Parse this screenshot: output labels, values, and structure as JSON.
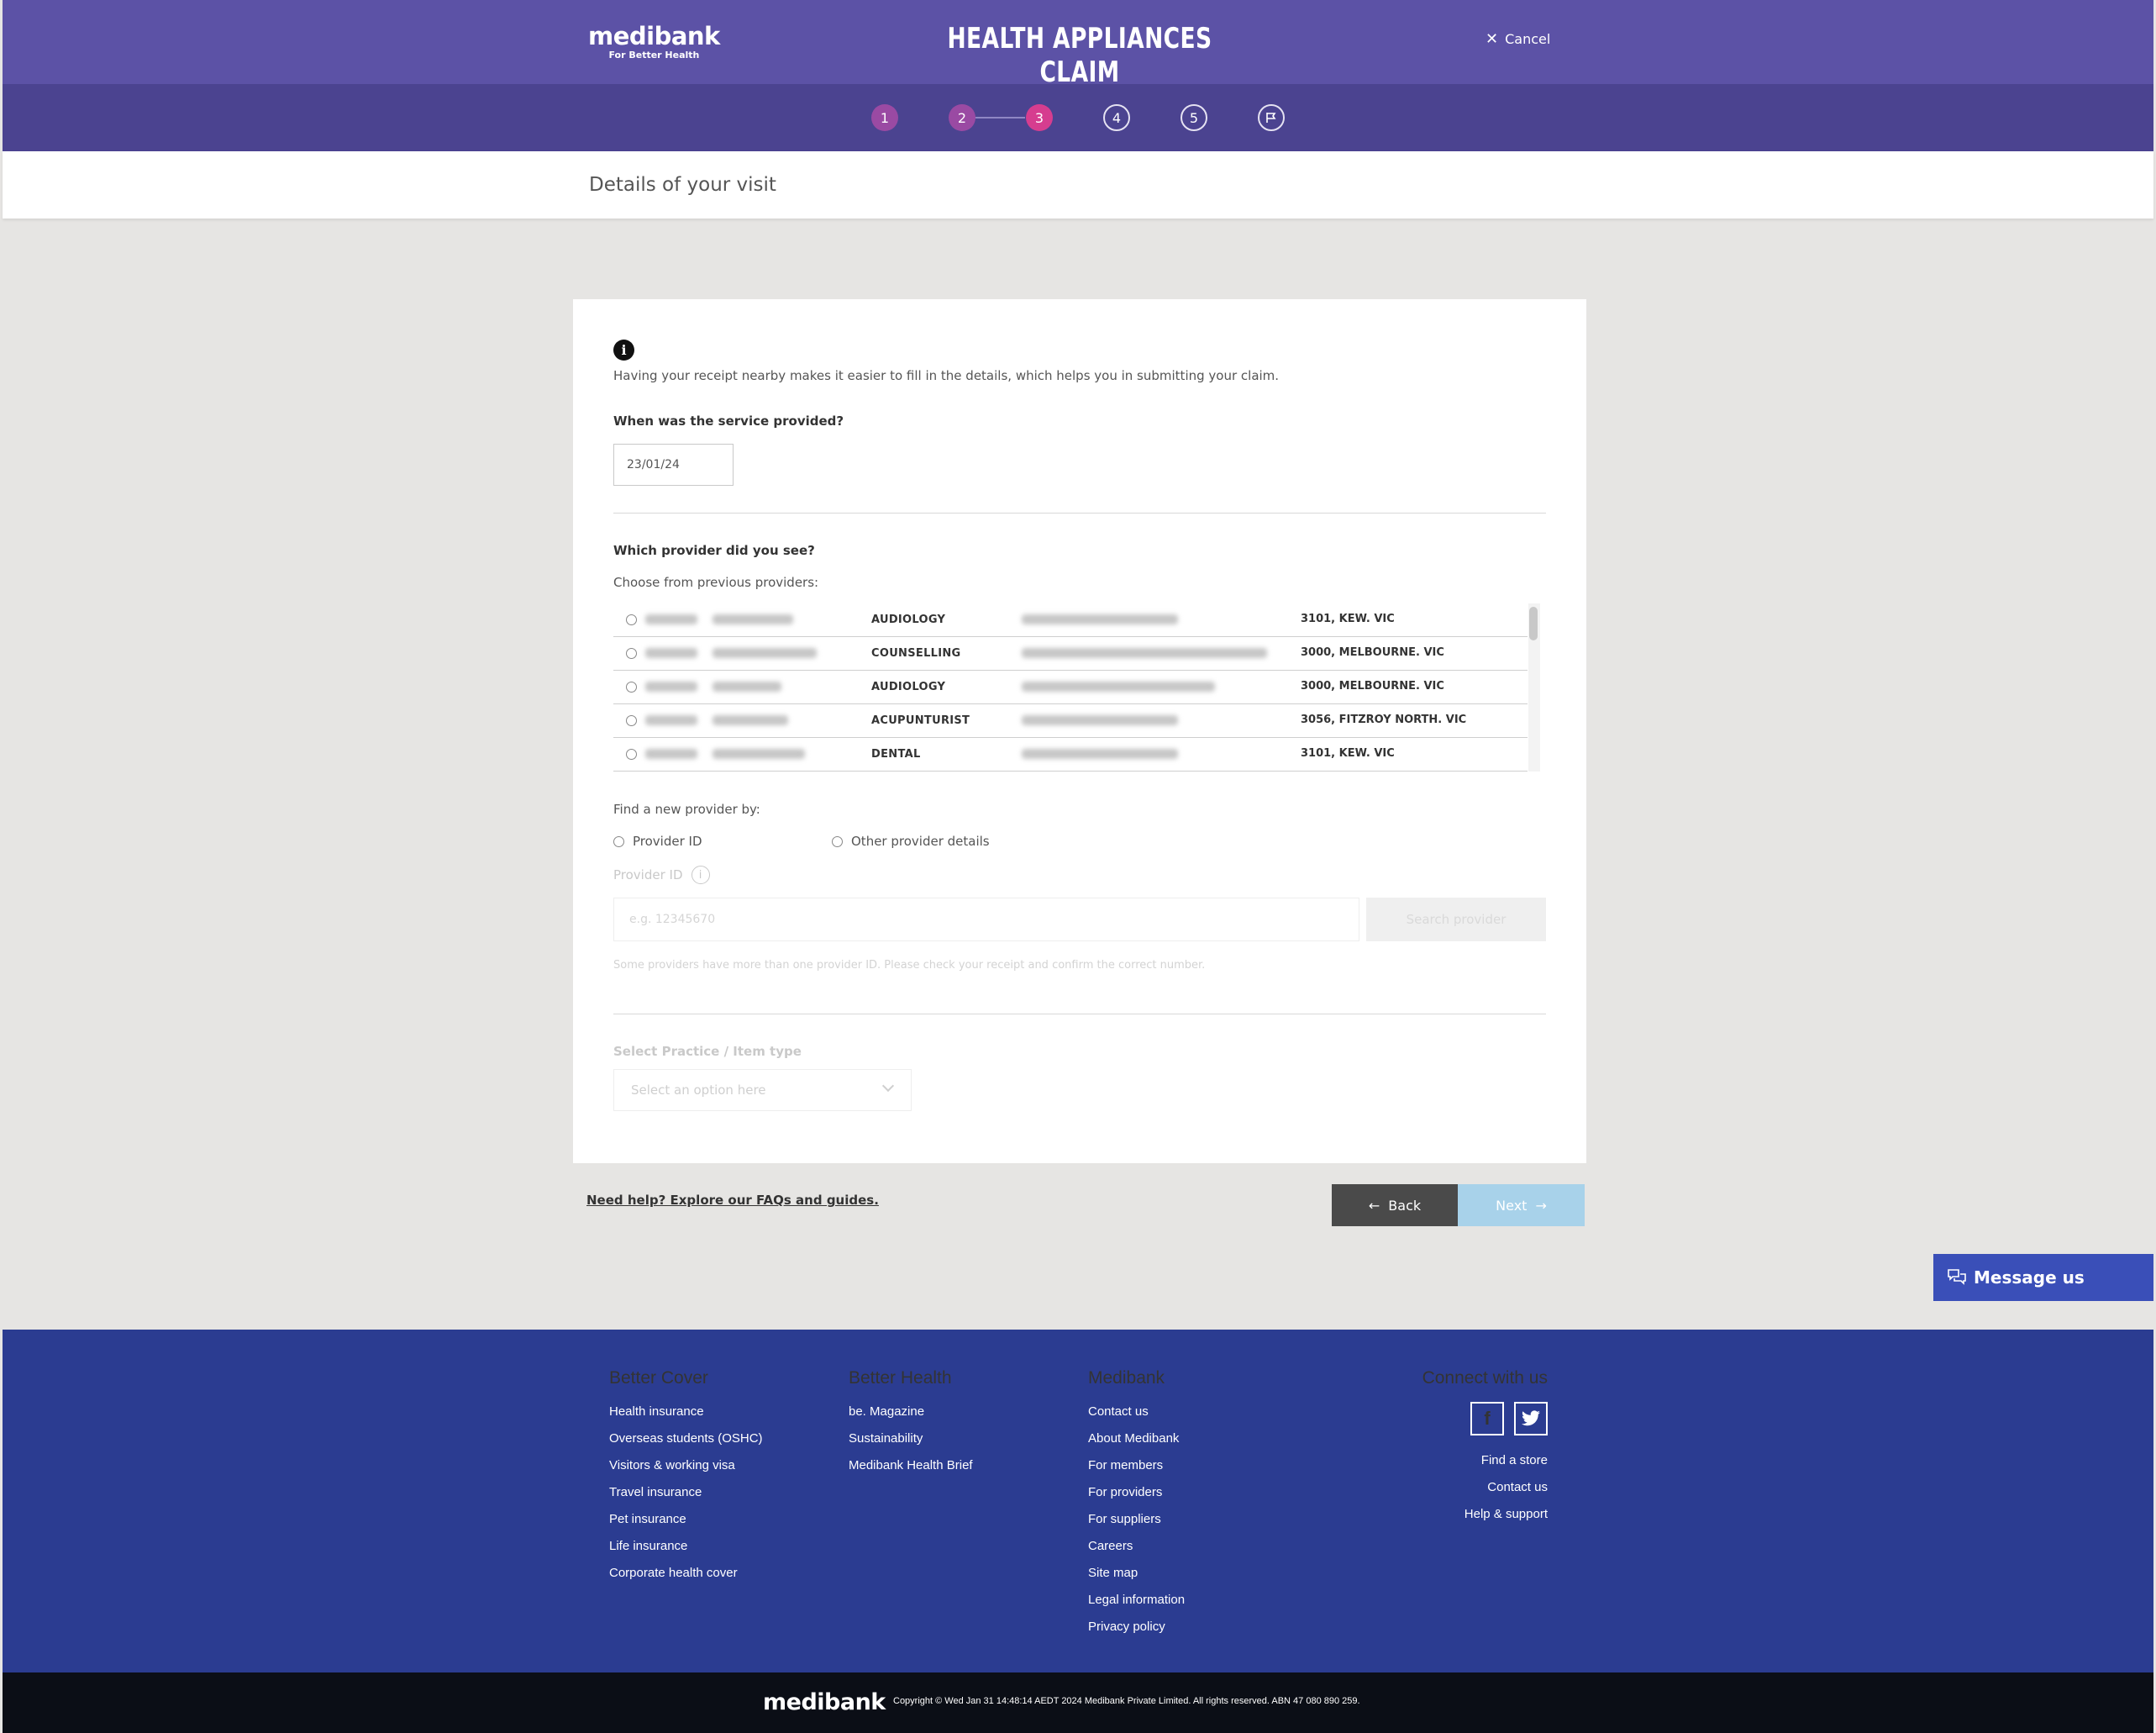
{
  "header": {
    "logo": "medibank",
    "tagline": "For Better Health",
    "title": "HEALTH APPLIANCES CLAIM",
    "cancel": "Cancel"
  },
  "steps": [
    "1",
    "2",
    "3",
    "4",
    "5"
  ],
  "subheader": {
    "title": "Details of your visit"
  },
  "form": {
    "info_text": "Having your receipt nearby makes it easier to fill in the details, which helps you in submitting your claim.",
    "service_question": "When was the service provided?",
    "service_date": "23/01/24",
    "provider_question": "Which provider did you see?",
    "previous_hint": "Choose from previous providers:",
    "providers": [
      {
        "type": "AUDIOLOGY",
        "location": "3101, KEW. VIC"
      },
      {
        "type": "COUNSELLING",
        "location": "3000, MELBOURNE. VIC"
      },
      {
        "type": "AUDIOLOGY",
        "location": "3000, MELBOURNE. VIC"
      },
      {
        "type": "ACUPUNTURIST",
        "location": "3056, FITZROY NORTH. VIC"
      },
      {
        "type": "DENTAL",
        "location": "3101, KEW. VIC"
      }
    ],
    "find_new": "Find a new provider by:",
    "option_provider_id": "Provider ID",
    "option_other": "Other provider details",
    "provider_id_label": "Provider ID",
    "provider_id_placeholder": "e.g. 12345670",
    "search_button": "Search provider",
    "provider_id_note": "Some providers have more than one provider ID. Please check your receipt and confirm the correct number.",
    "practice_label": "Select Practice / Item type",
    "practice_placeholder": "Select an option here"
  },
  "nav": {
    "help": "Need help? Explore our FAQs and guides.",
    "back": "Back",
    "next": "Next"
  },
  "message_us": "Message us",
  "footer": {
    "better_cover": {
      "title": "Better Cover",
      "links": [
        "Health insurance",
        "Overseas students (OSHC)",
        "Visitors & working visa",
        "Travel insurance",
        "Pet insurance",
        "Life insurance",
        "Corporate health cover"
      ]
    },
    "better_health": {
      "title": "Better Health",
      "links": [
        "be. Magazine",
        "Sustainability",
        "Medibank Health Brief"
      ]
    },
    "medibank": {
      "title": "Medibank",
      "links": [
        "Contact us",
        "About Medibank",
        "For members",
        "For providers",
        "For suppliers",
        "Careers",
        "Site map",
        "Legal information",
        "Privacy policy"
      ]
    },
    "connect": {
      "title": "Connect with us",
      "links": [
        "Find a store",
        "Contact us",
        "Help & support"
      ]
    },
    "logo": "medibank",
    "copyright": "Copyright © Wed Jan 31 14:48:14 AEDT 2024 Medibank Private Limited. All rights reserved. ABN 47 080 890 259."
  }
}
